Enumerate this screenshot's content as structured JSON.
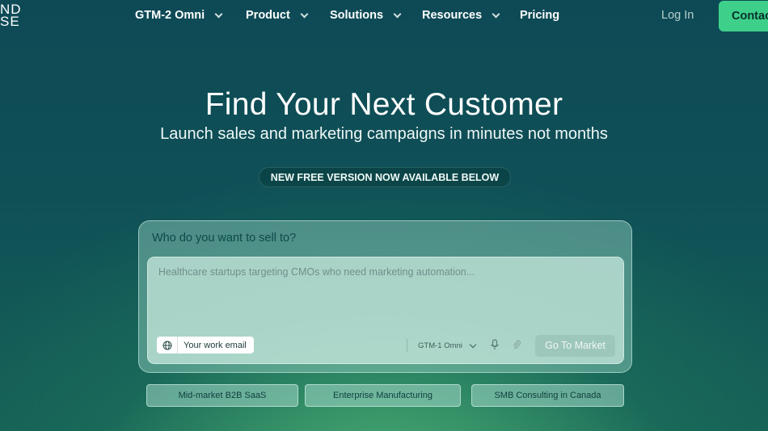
{
  "nav": {
    "logo_lines": [
      "ND",
      "SE"
    ],
    "items": [
      {
        "label": "GTM-2 Omni",
        "has_dropdown": true
      },
      {
        "label": "Product",
        "has_dropdown": true
      },
      {
        "label": "Solutions",
        "has_dropdown": true
      },
      {
        "label": "Resources",
        "has_dropdown": true
      },
      {
        "label": "Pricing",
        "has_dropdown": false
      }
    ],
    "login_label": "Log In",
    "contact_label": "Contac"
  },
  "hero": {
    "title": "Find Your Next Customer",
    "subtitle": "Launch sales and marketing campaigns in minutes not months",
    "badge": "NEW FREE VERSION NOW AVAILABLE BELOW"
  },
  "prompt_card": {
    "label": "Who do you want to sell to?",
    "placeholder": "Healthcare startups targeting CMOs who need marketing automation...",
    "email_placeholder": "Your work email",
    "model_selected": "GTM-1 Omni",
    "submit_label": "Go To Market"
  },
  "suggestions": [
    "Mid-market B2B SaaS",
    "Enterprise Manufacturing",
    "SMB Consulting in Canada"
  ],
  "colors": {
    "accent": "#3ed08a",
    "background_top": "#0e4a56",
    "background_glow": "#5abe78"
  },
  "icons": {
    "email": "globe-icon",
    "model": "chevron-down-icon",
    "voice": "microphone-icon",
    "attach": "paperclip-icon"
  }
}
